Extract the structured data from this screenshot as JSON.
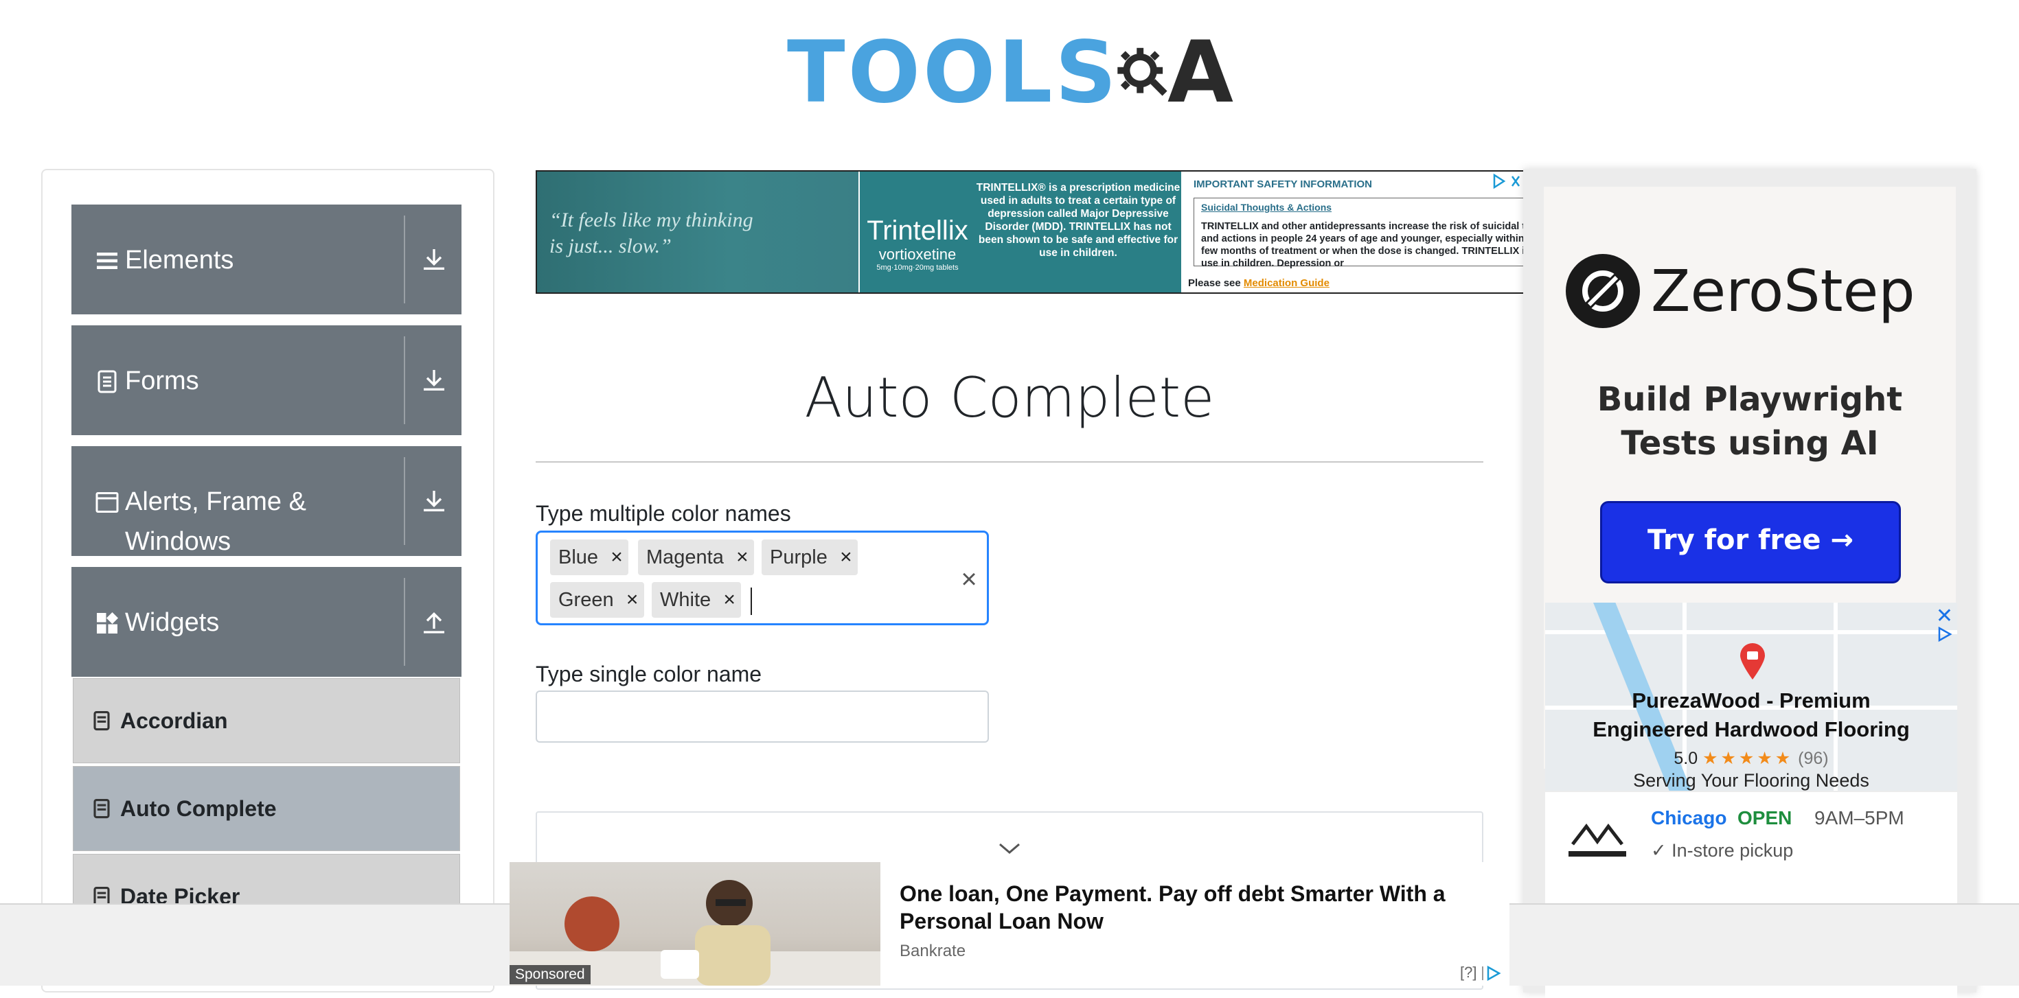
{
  "header": {
    "logo_text_left": "TOOLS",
    "logo_text_right": "A"
  },
  "sidebar": {
    "groups": [
      {
        "label": "Elements"
      },
      {
        "label": "Forms"
      },
      {
        "label": "Alerts, Frame &",
        "label2": "Windows"
      },
      {
        "label": "Widgets"
      }
    ],
    "items": [
      {
        "label": "Accordian"
      },
      {
        "label": "Auto Complete"
      },
      {
        "label": "Date Picker"
      }
    ]
  },
  "top_ad": {
    "quote": "“It feels like my thinking is just... slow.”",
    "brand": "Trintellix",
    "brand_generic": "vortioxetine",
    "brand_dose": "5mg·10mg·20mg tablets",
    "description": "TRINTELLIX® is a prescription medicine used in adults to treat a certain type of depression called Major Depressive Disorder (MDD). TRINTELLIX has not been shown to be safe and effective for use in children.",
    "isi_heading": "IMPORTANT SAFETY INFORMATION",
    "isi_subheading": "Suicidal Thoughts & Actions",
    "isi_text": "TRINTELLIX and other antidepressants increase the risk of suicidal thoughts and actions in people 24 years of age and younger, especially within the first few months of treatment or when the dose is changed. TRINTELLIX is not for use in children. Depression or",
    "isi_footer": "Please see",
    "isi_link": "Medication Guide"
  },
  "main": {
    "title": "Auto Complete",
    "multi_label": "Type multiple color names",
    "chips": [
      "Blue",
      "Magenta",
      "Purple",
      "Green",
      "White"
    ],
    "chip_remove": "×",
    "clear": "×",
    "single_label": "Type single color name",
    "single_value": ""
  },
  "right_ad": {
    "brand": "ZeroStep",
    "subtitle_line1": "Build Playwright",
    "subtitle_line2": "Tests using AI",
    "cta": "Try for free →",
    "map_close": "✕",
    "biz_name_line1": "PurezaWood - Premium",
    "biz_name_line2": "Engineered Hardwood Flooring",
    "rating": "5.0",
    "stars": "★★★★★",
    "review_count": "(96)",
    "serving": "Serving Your Flooring Needs",
    "city": "Chicago",
    "open": "OPEN",
    "hours": "9AM–5PM",
    "pickup": "In-store pickup"
  },
  "bottom_ad": {
    "sponsored": "Sponsored",
    "headline": "One loan, One Payment. Pay off debt Smarter With a Personal Loan Now",
    "source": "Bankrate",
    "help": "[?]"
  },
  "colors": {
    "accent": "#2684ff",
    "sidebar_group": "#6c757d",
    "logo_blue": "#4aa3df"
  }
}
